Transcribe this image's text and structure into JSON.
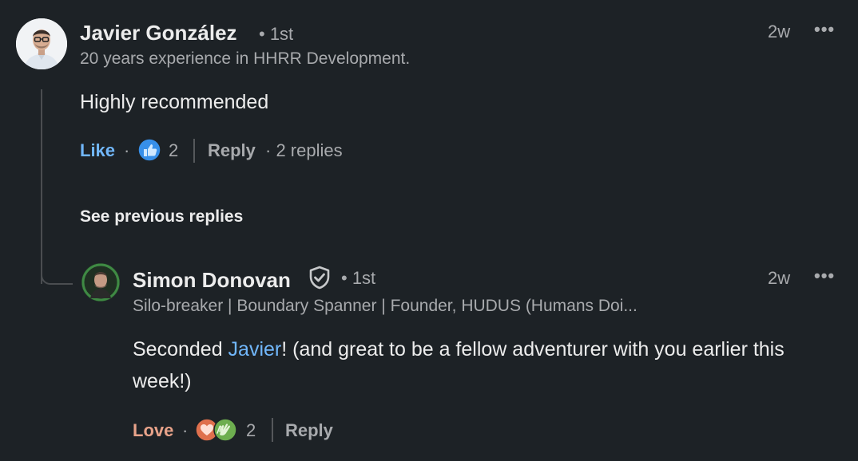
{
  "comment": {
    "author_name": "Javier González",
    "degree": "• 1st",
    "headline": "20 years experience in HHRR Development.",
    "timestamp": "2w",
    "more_label": "•••",
    "text": "Highly recommended",
    "like_label": "Like",
    "dot": "·",
    "reaction_count": "2",
    "reply_label": "Reply",
    "replies_count": "· 2 replies"
  },
  "see_previous_label": "See previous replies",
  "reply": {
    "author_name": "Simon Donovan",
    "degree": "• 1st",
    "headline": "Silo-breaker | Boundary Spanner | Founder, HUDUS (Humans Doi...",
    "timestamp": "2w",
    "more_label": "•••",
    "text_before": "Seconded ",
    "mention": "Javier",
    "text_after": "! (and great to be a fellow adventurer with you earlier this week!)",
    "love_label": "Love",
    "dot": "·",
    "reaction_count": "2",
    "reply_label": "Reply"
  },
  "colors": {
    "background": "#1d2226",
    "link_blue": "#71b7fb",
    "love_accent": "#e8a38a",
    "muted_text": "#a8aaad"
  },
  "icons": {
    "like_reaction": "thumbs-up-icon",
    "love_reaction": "heart-icon",
    "celebrate_reaction": "clapping-hands-icon",
    "verified": "shield-check-icon"
  }
}
